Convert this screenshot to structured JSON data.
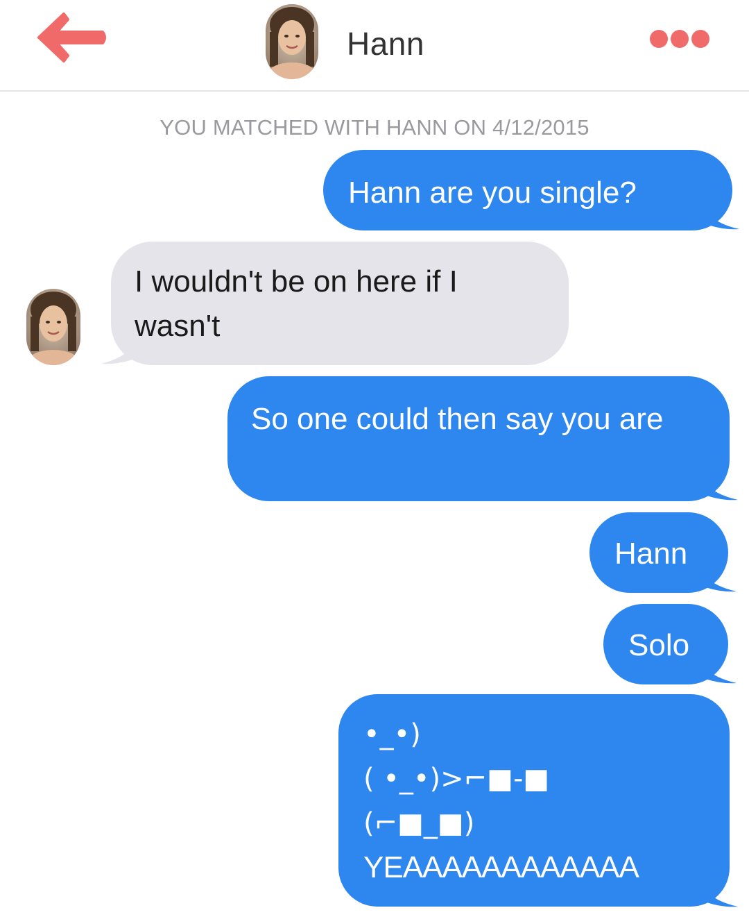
{
  "header": {
    "contact_name": "Hann",
    "back_icon": "back-arrow-icon",
    "more_icon": "more-dots-icon",
    "accent_color": "#f06a6a"
  },
  "match_banner": "YOU MATCHED WITH HANN ON 4/12/2015",
  "messages": [
    {
      "sender": "me",
      "text": "Hann are you single?"
    },
    {
      "sender": "them",
      "text": "I wouldn't be on here if I wasn't"
    },
    {
      "sender": "me",
      "text": "So one could then say you are"
    },
    {
      "sender": "me",
      "text": "Hann"
    },
    {
      "sender": "me",
      "text": "Solo"
    },
    {
      "sender": "me",
      "lines": [
        "•_•)",
        "( •_•)>⌐■-■",
        "(⌐■_■)",
        "YEAAAAAAAAAAAA"
      ]
    }
  ],
  "colors": {
    "outgoing_bubble": "#2e86ef",
    "incoming_bubble": "#e4e4ea",
    "banner_text": "#9a9a9e"
  }
}
